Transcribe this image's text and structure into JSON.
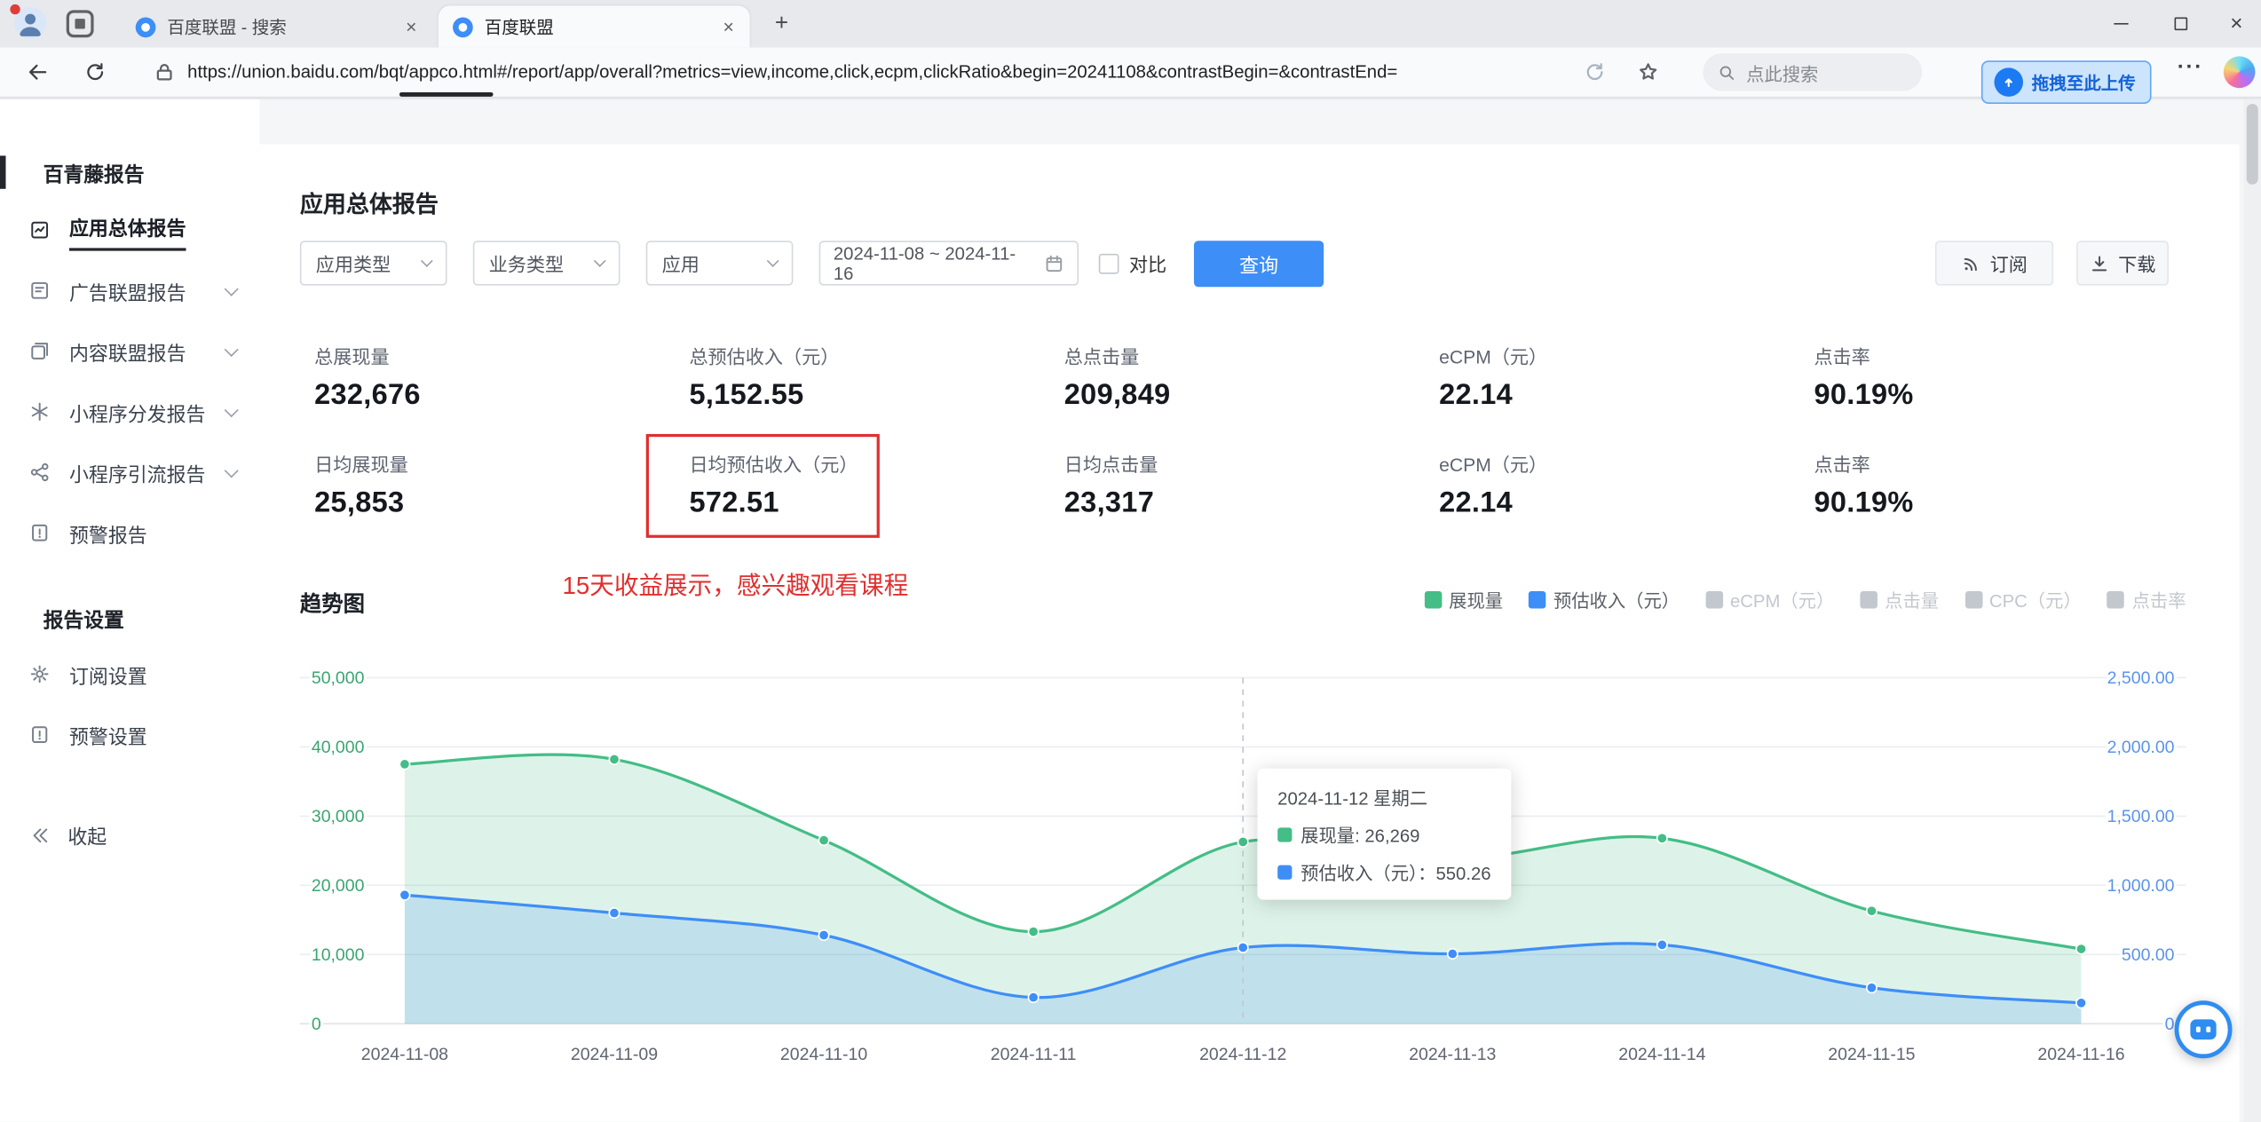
{
  "browser": {
    "tabs": [
      {
        "title": "百度联盟 - 搜索"
      },
      {
        "title": "百度联盟"
      }
    ],
    "url": "https://union.baidu.com/bqt/appco.html#/report/app/overall?metrics=view,income,click,ecpm,clickRatio&begin=20241108&contrastBegin=&contrastEnd=",
    "search_placeholder": "点此搜索",
    "upload_overlay_label": "拖拽至此上传"
  },
  "sidebar": {
    "sections": [
      {
        "title": "百青藤报告",
        "items": [
          {
            "label": "应用总体报告",
            "icon": "overall-report-icon",
            "active": true
          },
          {
            "label": "广告联盟报告",
            "icon": "ad-union-report-icon",
            "expandable": true
          },
          {
            "label": "内容联盟报告",
            "icon": "content-union-report-icon",
            "expandable": true
          },
          {
            "label": "小程序分发报告",
            "icon": "miniapp-distribution-report-icon",
            "expandable": true
          },
          {
            "label": "小程序引流报告",
            "icon": "miniapp-referral-report-icon",
            "expandable": true
          },
          {
            "label": "预警报告",
            "icon": "warning-report-icon"
          }
        ]
      },
      {
        "title": "报告设置",
        "items": [
          {
            "label": "订阅设置",
            "icon": "gear-icon"
          },
          {
            "label": "预警设置",
            "icon": "warning-settings-icon"
          }
        ]
      }
    ],
    "collapse_label": "收起"
  },
  "main": {
    "title": "应用总体报告",
    "filters": {
      "selects": [
        "应用类型",
        "业务类型",
        "应用"
      ],
      "date_range": "2024-11-08 ~ 2024-11-16",
      "contrast_label": "对比",
      "query_label": "查询"
    },
    "actions": {
      "subscribe_label": "订阅",
      "download_label": "下载"
    },
    "stats": [
      {
        "label": "总展现量",
        "value": "232,676"
      },
      {
        "label": "总预估收入（元）",
        "value": "5,152.55"
      },
      {
        "label": "总点击量",
        "value": "209,849"
      },
      {
        "label": "eCPM（元）",
        "value": "22.14"
      },
      {
        "label": "点击率",
        "value": "90.19%"
      },
      {
        "label": "日均展现量",
        "value": "25,853"
      },
      {
        "label": "日均预估收入（元）",
        "value": "572.51",
        "highlighted": true
      },
      {
        "label": "日均点击量",
        "value": "23,317"
      },
      {
        "label": "eCPM（元）",
        "value": "22.14"
      },
      {
        "label": "点击率",
        "value": "90.19%"
      }
    ],
    "annotation": "15天收益展示，感兴趣观看课程",
    "chart_section_title": "趋势图"
  },
  "chart_data": {
    "type": "area",
    "title": "趋势图",
    "x": [
      "2024-11-08",
      "2024-11-09",
      "2024-11-10",
      "2024-11-11",
      "2024-11-12",
      "2024-11-13",
      "2024-11-14",
      "2024-11-15",
      "2024-11-16"
    ],
    "series": [
      {
        "name": "展现量",
        "axis": "left",
        "color": "#44bd87",
        "values": [
          37500,
          38200,
          26500,
          13300,
          26269,
          23800,
          26800,
          16300,
          10800
        ]
      },
      {
        "name": "预估收入（元）",
        "axis": "right",
        "color": "#3e8ef7",
        "values": [
          930,
          800,
          640,
          190,
          550.26,
          505,
          570,
          260,
          150
        ]
      }
    ],
    "left_axis": {
      "min": 0,
      "max": 50000,
      "tick_labels": [
        "0",
        "10,000",
        "20,000",
        "30,000",
        "40,000",
        "50,000"
      ],
      "color": "#3aa571"
    },
    "right_axis": {
      "min": 0,
      "max": 2500,
      "tick_labels": [
        "0",
        "500.00",
        "1,000.00",
        "1,500.00",
        "2,000.00",
        "2,500.00"
      ],
      "color": "#5b93ea"
    },
    "legend": [
      {
        "label": "展现量",
        "color": "#44bd87",
        "active": true
      },
      {
        "label": "预估收入（元）",
        "color": "#3e8ef7",
        "active": true
      },
      {
        "label": "eCPM（元）",
        "active": false
      },
      {
        "label": "点击量",
        "active": false
      },
      {
        "label": "CPC（元）",
        "active": false
      },
      {
        "label": "点击率",
        "active": false
      }
    ],
    "marker_index": 4,
    "grid": true,
    "legend_position": "top-right",
    "tooltip": {
      "title": "2024-11-12 星期二",
      "rows": [
        {
          "color": "#44bd87",
          "text": "展现量: 26,269"
        },
        {
          "color": "#3e8ef7",
          "text": "预估收入（元）：550.26"
        }
      ]
    }
  }
}
